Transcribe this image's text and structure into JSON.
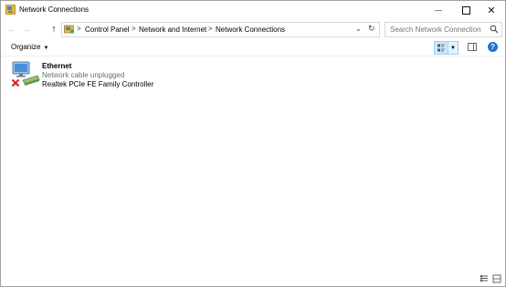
{
  "window": {
    "title": "Network Connections"
  },
  "titlebar": {
    "minimize_glyph": "—",
    "close_glyph": "✕"
  },
  "nav": {
    "back_glyph": "←",
    "forward_glyph": "→",
    "up_glyph": "↑",
    "breadcrumbs": [
      "Control Panel",
      "Network and Internet",
      "Network Connections"
    ],
    "separator": ">",
    "dropdown_glyph": "⌄",
    "refresh_glyph": "↻"
  },
  "search": {
    "placeholder": "Search Network Connections",
    "icon": "search-icon"
  },
  "toolbar": {
    "organize_label": "Organize",
    "organize_caret": "▼",
    "view_dropdown_glyph": "▼",
    "help_glyph": "?"
  },
  "connections": [
    {
      "name": "Ethernet",
      "status": "Network cable unplugged",
      "device": "Realtek PCIe FE Family Controller",
      "icon": "ethernet-adapter-icon",
      "state_icon": "disconnected-x-icon"
    }
  ],
  "colors": {
    "accent": "#1e73d2",
    "view_selected_bg": "#cce8ff",
    "view_selected_border": "#99d1ff",
    "disconnected_x": "#d9232a",
    "status_gray": "#6d6d6d"
  },
  "statusbar": {
    "icons": [
      "details-view-icon",
      "tiles-view-icon"
    ]
  }
}
